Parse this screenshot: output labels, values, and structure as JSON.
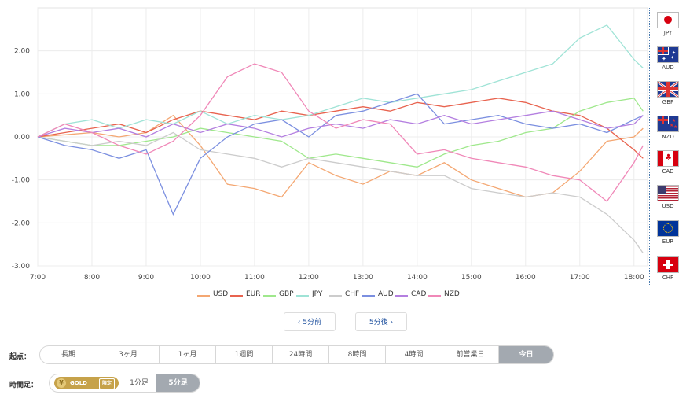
{
  "chart_data": {
    "type": "line",
    "xlabel": "",
    "ylabel": "",
    "ylim": [
      -3,
      3
    ],
    "xlim": [
      "7:00",
      "18:15"
    ],
    "x_ticks": [
      "7:00",
      "8:00",
      "9:00",
      "10:00",
      "11:00",
      "12:00",
      "13:00",
      "14:00",
      "15:00",
      "16:00",
      "17:00",
      "18:00"
    ],
    "y_ticks": [
      "2.00",
      "1.00",
      "0.00",
      "-1.00",
      "-2.00",
      "-3.00"
    ],
    "grid": true,
    "legend": "bottom",
    "colors": {
      "USD": "#f4a772",
      "EUR": "#e8634f",
      "GBP": "#9fe88c",
      "JPY": "#9fe3d6",
      "CHF": "#cccccc",
      "AUD": "#7b8fe0",
      "CAD": "#b47fe0",
      "NZD": "#f088b8"
    },
    "x": [
      "7:00",
      "7:30",
      "8:00",
      "8:30",
      "9:00",
      "9:30",
      "10:00",
      "10:30",
      "11:00",
      "11:30",
      "12:00",
      "12:30",
      "13:00",
      "13:30",
      "14:00",
      "14:30",
      "15:00",
      "15:30",
      "16:00",
      "16:30",
      "17:00",
      "17:30",
      "18:00",
      "18:10"
    ],
    "series": [
      {
        "name": "USD",
        "values": [
          0.0,
          0.05,
          0.1,
          0.0,
          0.1,
          0.5,
          -0.2,
          -1.1,
          -1.2,
          -1.4,
          -0.6,
          -0.9,
          -1.1,
          -0.8,
          -0.9,
          -0.6,
          -1.0,
          -1.2,
          -1.4,
          -1.3,
          -0.8,
          -0.1,
          0.0,
          0.2
        ]
      },
      {
        "name": "EUR",
        "values": [
          0.0,
          0.1,
          0.2,
          0.3,
          0.1,
          0.4,
          0.6,
          0.5,
          0.4,
          0.6,
          0.5,
          0.6,
          0.7,
          0.6,
          0.8,
          0.7,
          0.8,
          0.9,
          0.8,
          0.6,
          0.5,
          0.2,
          -0.3,
          -0.5
        ]
      },
      {
        "name": "GBP",
        "values": [
          0.0,
          -0.1,
          -0.2,
          -0.2,
          -0.1,
          0.0,
          0.2,
          0.1,
          0.0,
          -0.1,
          -0.5,
          -0.4,
          -0.5,
          -0.6,
          -0.7,
          -0.4,
          -0.2,
          -0.1,
          0.1,
          0.2,
          0.6,
          0.8,
          0.9,
          0.6
        ]
      },
      {
        "name": "JPY",
        "values": [
          0.0,
          0.3,
          0.4,
          0.2,
          0.4,
          0.3,
          0.6,
          0.3,
          0.5,
          0.4,
          0.5,
          0.7,
          0.9,
          0.8,
          0.9,
          1.0,
          1.1,
          1.3,
          1.5,
          1.7,
          2.3,
          2.6,
          1.8,
          1.6
        ]
      },
      {
        "name": "CHF",
        "values": [
          0.0,
          -0.1,
          -0.2,
          -0.1,
          -0.2,
          0.1,
          -0.3,
          -0.4,
          -0.5,
          -0.7,
          -0.5,
          -0.6,
          -0.7,
          -0.8,
          -0.9,
          -0.9,
          -1.2,
          -1.3,
          -1.4,
          -1.3,
          -1.4,
          -1.8,
          -2.4,
          -2.7
        ]
      },
      {
        "name": "AUD",
        "values": [
          0.0,
          -0.2,
          -0.3,
          -0.5,
          -0.3,
          -1.8,
          -0.5,
          0.0,
          0.3,
          0.4,
          0.0,
          0.5,
          0.6,
          0.8,
          1.0,
          0.3,
          0.4,
          0.5,
          0.3,
          0.2,
          0.3,
          0.1,
          0.4,
          0.5
        ]
      },
      {
        "name": "CAD",
        "values": [
          0.0,
          0.2,
          0.1,
          0.2,
          0.0,
          0.3,
          0.1,
          0.3,
          0.2,
          0.0,
          0.2,
          0.3,
          0.2,
          0.4,
          0.3,
          0.5,
          0.3,
          0.4,
          0.5,
          0.6,
          0.4,
          0.2,
          0.3,
          0.5
        ]
      },
      {
        "name": "NZD",
        "values": [
          0.0,
          0.3,
          0.1,
          -0.2,
          -0.4,
          -0.1,
          0.5,
          1.4,
          1.7,
          1.5,
          0.6,
          0.2,
          0.4,
          0.3,
          -0.4,
          -0.3,
          -0.5,
          -0.6,
          -0.7,
          -0.9,
          -1.0,
          -1.5,
          -0.6,
          -0.2
        ]
      }
    ]
  },
  "flags": [
    {
      "code": "JPY",
      "icon": "japan-flag-icon"
    },
    {
      "code": "AUD",
      "icon": "australia-flag-icon"
    },
    {
      "code": "GBP",
      "icon": "uk-flag-icon"
    },
    {
      "code": "NZD",
      "icon": "new-zealand-flag-icon"
    },
    {
      "code": "CAD",
      "icon": "canada-flag-icon"
    },
    {
      "code": "USD",
      "icon": "usa-flag-icon"
    },
    {
      "code": "EUR",
      "icon": "eu-flag-icon"
    },
    {
      "code": "CHF",
      "icon": "switzerland-flag-icon"
    }
  ],
  "nav": {
    "prev_label": "‹ 5分前",
    "next_label": "5分後 ›"
  },
  "start_point": {
    "label": "起点：",
    "options": [
      "長期",
      "3ヶ月",
      "1ヶ月",
      "1週間",
      "24時間",
      "8時間",
      "4時間",
      "前営業日",
      "今日"
    ],
    "selected": "今日"
  },
  "timeframe": {
    "label": "時間足：",
    "gold_label": "GOLD",
    "gold_limited": "限定",
    "gold_icon": "gold-coin-icon",
    "options": [
      "1分足",
      "5分足"
    ],
    "selected": "5分足"
  }
}
